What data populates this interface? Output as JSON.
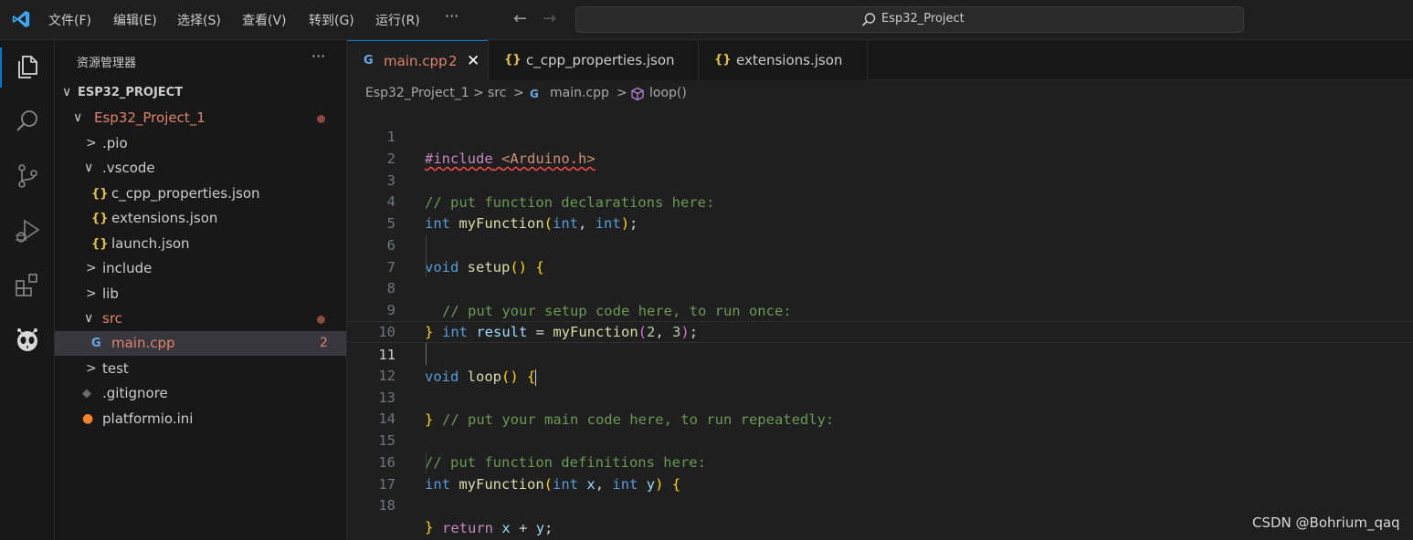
{
  "titlebar": {
    "menu": [
      "文件(F)",
      "编辑(E)",
      "选择(S)",
      "查看(V)",
      "转到(G)",
      "运行(R)"
    ],
    "more": "···",
    "back_arrow": "←",
    "forward_arrow": "→",
    "search_text": "Esp32_Project"
  },
  "activitybar": {
    "icons": [
      "explorer-icon",
      "search-icon",
      "source-control-icon",
      "run-debug-icon",
      "extensions-icon",
      "platformio-icon"
    ]
  },
  "sidebar": {
    "title": "资源管理器",
    "more": "···",
    "tree": [
      {
        "label": "ESP32_PROJECT",
        "chevron": "∨",
        "type": "root"
      },
      {
        "label": "Esp32_Project_1",
        "chevron": "∨",
        "type": "folder",
        "modified": true
      },
      {
        "label": ".pio",
        "chevron": ">",
        "type": "folder"
      },
      {
        "label": ".vscode",
        "chevron": "∨",
        "type": "folder"
      },
      {
        "label": "c_cpp_properties.json",
        "icon": "{}",
        "type": "json"
      },
      {
        "label": "extensions.json",
        "icon": "{}",
        "type": "json"
      },
      {
        "label": "launch.json",
        "icon": "{}",
        "type": "json"
      },
      {
        "label": "include",
        "chevron": ">",
        "type": "folder"
      },
      {
        "label": "lib",
        "chevron": ">",
        "type": "folder"
      },
      {
        "label": "src",
        "chevron": "∨",
        "type": "folder",
        "modified": true
      },
      {
        "label": "main.cpp",
        "icon": "G",
        "type": "cpp",
        "badge": "2",
        "selected": true
      },
      {
        "label": "test",
        "chevron": ">",
        "type": "folder"
      },
      {
        "label": ".gitignore",
        "icon": "◆",
        "type": "git"
      },
      {
        "label": "platformio.ini",
        "icon": "●",
        "type": "ini"
      }
    ]
  },
  "tabs": [
    {
      "label": "main.cpp",
      "icon": "G",
      "badge": "2",
      "close": "✕",
      "active": true
    },
    {
      "label": "c_cpp_properties.json",
      "icon": "{}"
    },
    {
      "label": "extensions.json",
      "icon": "{}"
    }
  ],
  "breadcrumb": {
    "items": [
      "Esp32_Project_1",
      "src",
      "main.cpp",
      "loop()"
    ],
    "separator": ">"
  },
  "code": {
    "line_numbers": [
      "1",
      "2",
      "3",
      "4",
      "5",
      "6",
      "7",
      "8",
      "9",
      "10",
      "11",
      "12",
      "13",
      "14",
      "15",
      "16",
      "17",
      "18"
    ],
    "current_line": "11",
    "l1_include": "#include",
    "l1_header": "<Arduino.h>",
    "l3": "// put function declarations here:",
    "l4_int": "int",
    "l4_fn": "myFunction",
    "l4_int2": "int",
    "l4_int3": "int",
    "l6_void": "void",
    "l6_fn": "setup",
    "l7": "// put your setup code here, to run once:",
    "l8_int": "int",
    "l8_var": "result",
    "l8_fn": "myFunction",
    "l8_a": "2",
    "l8_b": "3",
    "l11_void": "void",
    "l11_fn": "loop",
    "l12": "// put your main code here, to run repeatedly:",
    "l15": "// put function definitions here:",
    "l16_int": "int",
    "l16_fn": "myFunction",
    "l16_int2": "int",
    "l16_x": "x",
    "l16_int3": "int",
    "l16_y": "y",
    "l17_return": "return",
    "l17_x": "x",
    "l17_y": "y"
  },
  "watermark": "CSDN @Bohrium_qaq",
  "colors": {
    "accent": "#0078d4",
    "modified": "#e2836b",
    "json_icon": "#e2c04a"
  }
}
